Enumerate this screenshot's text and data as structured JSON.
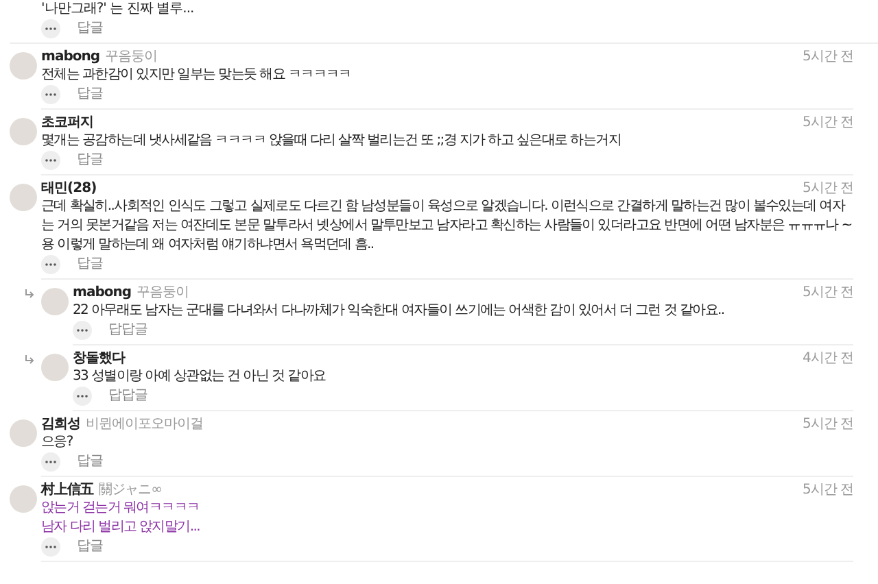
{
  "partial_comment": {
    "lines": [
      "'나만그래?' 는 진짜 별루..."
    ],
    "reply_label": "답글"
  },
  "comments": [
    {
      "name": "mabong",
      "tag": "꾸음둥이",
      "time": "5시간 전",
      "color": "#222222",
      "lines": [
        "전체는 과한감이 있지만 일부는 맞는듯 해요 ㅋㅋㅋㅋㅋ"
      ],
      "reply_label": "답글"
    },
    {
      "name": "초코퍼지",
      "time": "5시간 전",
      "color": "#222222",
      "lines": [
        "몇개는 공감하는데 냇사세같음 ㅋㅋㅋㅋ 앉을때 다리 살짝 벌리는건 또 ;;경 지가 하고 싶은대로 하는거지"
      ],
      "reply_label": "답글"
    },
    {
      "name": "태민(28)",
      "time": "5시간 전",
      "color": "#222222",
      "lines": [
        "근데 확실히..사회적인 인식도 그렇고 실제로도 다르긴 함 남성분들이 육성으로 알겠습니다. 이런식으로 간결하게 말하는건 많이 볼수있는데 여자는 거의 못본거같음 저는 여잔데도 본문 말투라서 넷상에서 말투만보고 남자라고 확신하는 사람들이 있더라고요 반면에 어떤 남자분은 ㅠㅠㅠ나 ~용 이렇게 말하는데 왜 여자처럼 얘기하냐면서 욕먹던데 흠.."
      ],
      "reply_label": "답글",
      "children": [
        {
          "name": "mabong",
          "tag": "꾸음둥이",
          "time": "5시간 전",
          "color": "#222222",
          "lines": [
            "22 아무래도 남자는 군대를 다녀와서 다나까체가 익숙한대 여자들이 쓰기에는 어색한 감이 있어서 더 그런 것 같아요.."
          ],
          "reply_label": "답답글"
        },
        {
          "name": "창돌했다",
          "time": "4시간 전",
          "color": "#222222",
          "lines": [
            "33 성별이랑 아예 상관없는 건 아닌 것 같아요"
          ],
          "reply_label": "답답글"
        }
      ]
    },
    {
      "name": "김희성",
      "tag": "비뮌에이포오마이걸",
      "time": "5시간 전",
      "color": "#222222",
      "lines": [
        "으응?"
      ],
      "reply_label": "답글"
    },
    {
      "name": "村上信五",
      "tag": "關ジャニ∞",
      "time": "5시간 전",
      "color": "#8b2fa5",
      "lines": [
        "앉는거 걷는거 뭐여ㅋㅋㅋㅋ",
        "남자 다리 벌리고 앉지말기..."
      ],
      "reply_label": "답글"
    }
  ]
}
